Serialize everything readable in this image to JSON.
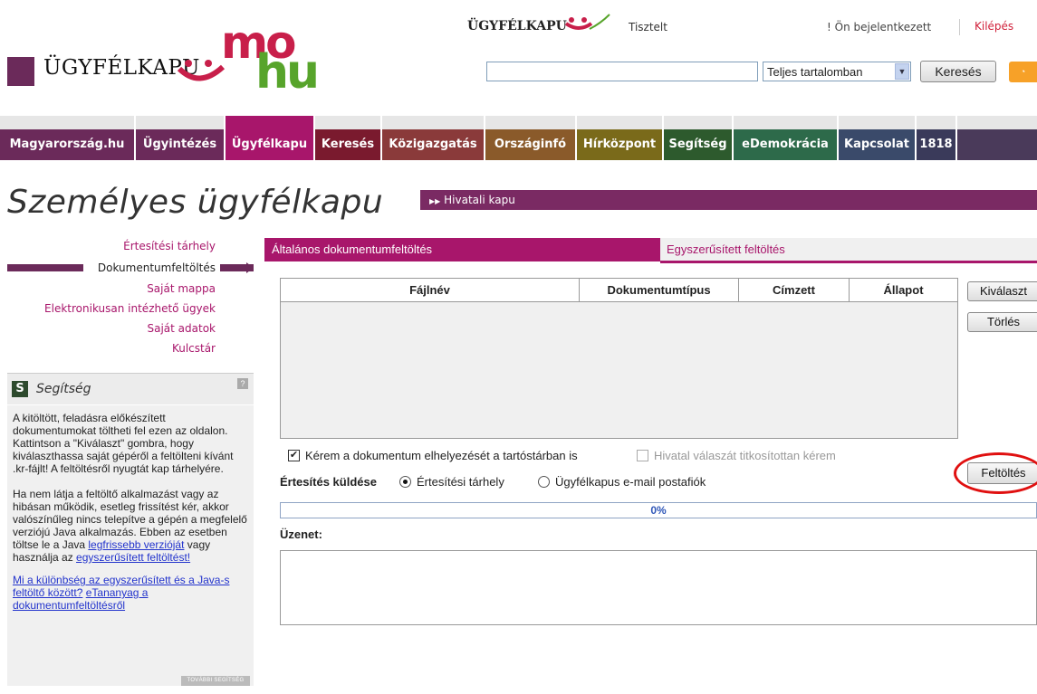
{
  "header": {
    "logo_text": "ÜGYFÉLKAPU",
    "mohu_mo": "mo",
    "mohu_hu": "hu",
    "small_logo_text": "ÜGYFÉLKAPU",
    "greeting": "Tisztelt",
    "login_status": "! Ön bejelentkezett",
    "logout": "Kilépés",
    "search_placeholder": "",
    "search_scope": "Teljes tartalomban",
    "search_button": "Keresés",
    "rss_icon": "rss-icon"
  },
  "nav": [
    {
      "label": "Magyarország.hu",
      "color": "#6b2a5a"
    },
    {
      "label": "Ügyintézés",
      "color": "#6b2a5a"
    },
    {
      "label": "Ügyfélkapu",
      "color": "#a8166b",
      "active": true
    },
    {
      "label": "Keresés",
      "color": "#7a1a2e"
    },
    {
      "label": "Közigazgatás",
      "color": "#8a3a3a"
    },
    {
      "label": "Országinfó",
      "color": "#8a5a2a"
    },
    {
      "label": "Hírközpont",
      "color": "#7a6a1a"
    },
    {
      "label": "Segítség",
      "color": "#2d5a2d"
    },
    {
      "label": "eDemokrácia",
      "color": "#2d6a4a"
    },
    {
      "label": "Kapcsolat",
      "color": "#3a4a6a"
    },
    {
      "label": "1818",
      "color": "#3a3a5a"
    }
  ],
  "page": {
    "title": "Személyes ügyfélkapu",
    "hivatali_kapu": "Hivatali kapu"
  },
  "left_menu": [
    "Értesítési tárhely",
    "Dokumentumfeltöltés",
    "Saját mappa",
    "Elektronikusan intézhető ügyek",
    "Saját adatok",
    "Kulcstár"
  ],
  "help": {
    "title": "Segítség",
    "s_badge": "S",
    "q_badge": "?",
    "p1": "A kitöltött, feladásra előkészített dokumentumokat töltheti fel ezen az oldalon. Kattintson a \"Kiválaszt\" gombra, hogy kiválaszthassa saját gépéről a feltölteni kívánt .kr-fájlt! A feltöltésről nyugtát kap tárhelyére.",
    "p2_a": "Ha nem látja a feltöltő alkalmazást vagy az hibásan működik, esetleg frissítést kér, akkor valószínűleg nincs telepítve a gépén a megfelelő verziójú Java alkalmazás. Ebben az esetben töltse le a Java ",
    "p2_link1": "legfrissebb verzióját",
    "p2_b": " vagy használja az ",
    "p2_link2": "egyszerűsített feltöltést!",
    "link3": "Mi a különbség az egyszerűsített és a Java-s feltöltő között?",
    "link4": "eTananyag a dokumentumfeltöltésről",
    "more": "TOVÁBBI SEGÍTSÉG"
  },
  "tabs": {
    "active": "Általános dokumentumfeltöltés",
    "inactive": "Egyszerűsített feltöltés"
  },
  "table": {
    "columns": [
      "Fájlnév",
      "Dokumentumtípus",
      "Címzett",
      "Állapot"
    ],
    "rows": []
  },
  "buttons": {
    "kivalaszt": "Kiválaszt",
    "torles": "Törlés",
    "feltoltes": "Feltöltés"
  },
  "options": {
    "store_checkbox": "Kérem a dokumentum elhelyezését a tartóstárban is",
    "store_checked": true,
    "encrypt_checkbox": "Hivatal válaszát titkosítottan kérem",
    "encrypt_checked": false,
    "notify_label": "Értesítés küldése",
    "radio1": "Értesítési tárhely",
    "radio2": "Ügyfélkapus e-mail postafiók",
    "selected_radio": 1
  },
  "progress": {
    "value": 0,
    "text": "0%"
  },
  "message": {
    "label": "Üzenet:",
    "value": ""
  }
}
